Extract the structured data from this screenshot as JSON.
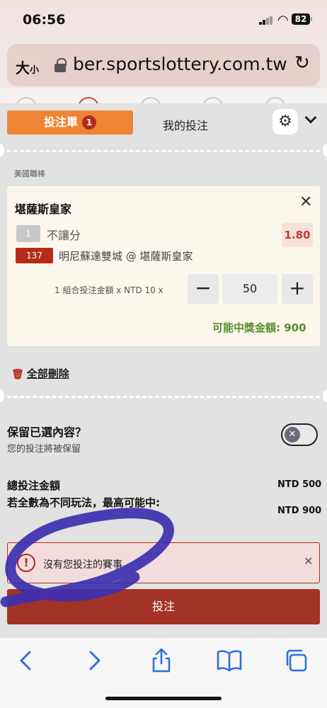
{
  "status": {
    "time": "06:56",
    "battery": "82"
  },
  "browser": {
    "text_size": "大",
    "text_size_small": "小",
    "url": "ber.sportslottery.com.tw"
  },
  "header": {
    "betslip_tab": "投注單",
    "betslip_count": "1",
    "my_bets_tab": "我的投注"
  },
  "slip": {
    "league": "美國職棒",
    "team": "堪薩斯皇家",
    "handicap_chip": "1",
    "handicap": "不讓分",
    "odds": "1.80",
    "match_code": "137",
    "match": "明尼蘇達雙城 @ 堪薩斯皇家",
    "combo": "1 組合投注金額 x NTD 10 x",
    "minus": "−",
    "plus": "+",
    "amount": "50",
    "payout": "可能中獎金額: 900"
  },
  "delete_all": "全部刪除",
  "keep": {
    "title": "保留已選內容？",
    "subtitle": "您的投注將被保留"
  },
  "totals": {
    "total_label": "總投注金額",
    "total_value": "NTD 500",
    "max_label": "若全數為不同玩法，最高可能中:",
    "max_value": "NTD 900"
  },
  "error": {
    "message": "沒有您投注的賽事"
  },
  "bet_button": "投注",
  "colors": {
    "accent": "#ef8434",
    "danger": "#b42b19",
    "win": "#5b8d2e",
    "scribble": "#3d2fb0"
  },
  "icons": [
    "signal-icon",
    "wifi-icon",
    "lock-icon",
    "reload-icon",
    "gear-icon",
    "chevron-down-icon",
    "close-icon",
    "trash-icon",
    "alert-icon",
    "back-icon",
    "forward-icon",
    "share-icon",
    "bookmarks-icon",
    "tabs-icon"
  ]
}
